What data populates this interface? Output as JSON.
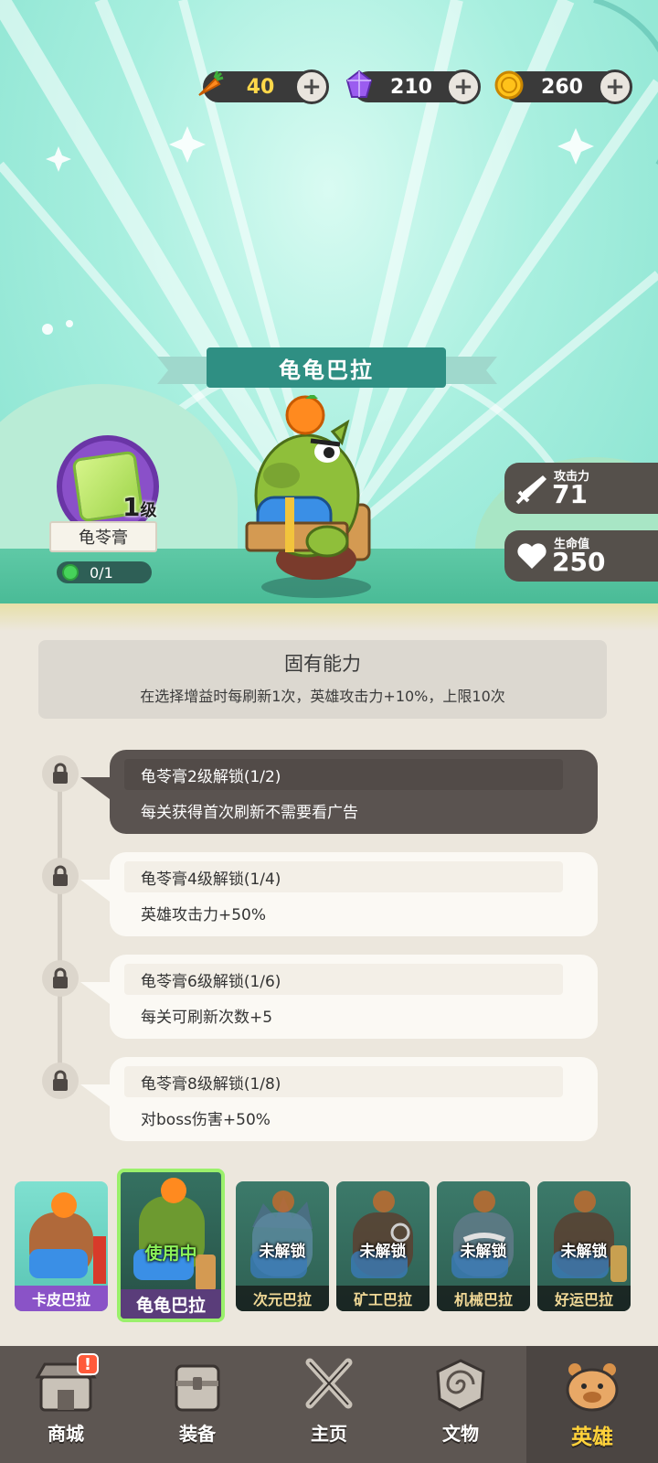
{
  "currency": {
    "carrot": {
      "value": "40",
      "icon": "carrot-icon"
    },
    "gem": {
      "value": "210",
      "icon": "gem-icon"
    },
    "coin": {
      "value": "260",
      "icon": "coin-icon"
    }
  },
  "hero": {
    "name": "龟龟巴拉",
    "attack_label": "攻击力",
    "attack_value": "71",
    "hp_label": "生命值",
    "hp_value": "250"
  },
  "item": {
    "level_num": "1",
    "level_unit": "级",
    "name": "龟苓膏",
    "progress": "0/1"
  },
  "ability": {
    "title": "固有能力",
    "desc": "在选择增益时每刷新1次，英雄攻击力+10%，上限10次"
  },
  "unlocks": [
    {
      "title": "龟苓膏2级解锁(1/2)",
      "desc": "每关获得首次刷新不需要看广告",
      "active": true
    },
    {
      "title": "龟苓膏4级解锁(1/4)",
      "desc": "英雄攻击力+50%",
      "active": false
    },
    {
      "title": "龟苓膏6级解锁(1/6)",
      "desc": "每关可刷新次数+5",
      "active": false
    },
    {
      "title": "龟苓膏8级解锁(1/8)",
      "desc": "对boss伤害+50%",
      "active": false
    }
  ],
  "heroes": [
    {
      "name": "卡皮巴拉",
      "status": ""
    },
    {
      "name": "龟龟巴拉",
      "status": "使用中"
    },
    {
      "name": "次元巴拉",
      "status": "未解锁"
    },
    {
      "name": "矿工巴拉",
      "status": "未解锁"
    },
    {
      "name": "机械巴拉",
      "status": "未解锁"
    },
    {
      "name": "好运巴拉",
      "status": "未解锁"
    }
  ],
  "nav": {
    "shop": "商城",
    "equip": "装备",
    "home": "主页",
    "relic": "文物",
    "hero": "英雄",
    "shop_badge": "!"
  },
  "colors": {
    "panel_dark": "#5a5350",
    "panel_light": "#fbf9f4",
    "nav_bg": "#5d5652",
    "active_nav": "#ffd23a",
    "in_use": "#8cf25a"
  }
}
